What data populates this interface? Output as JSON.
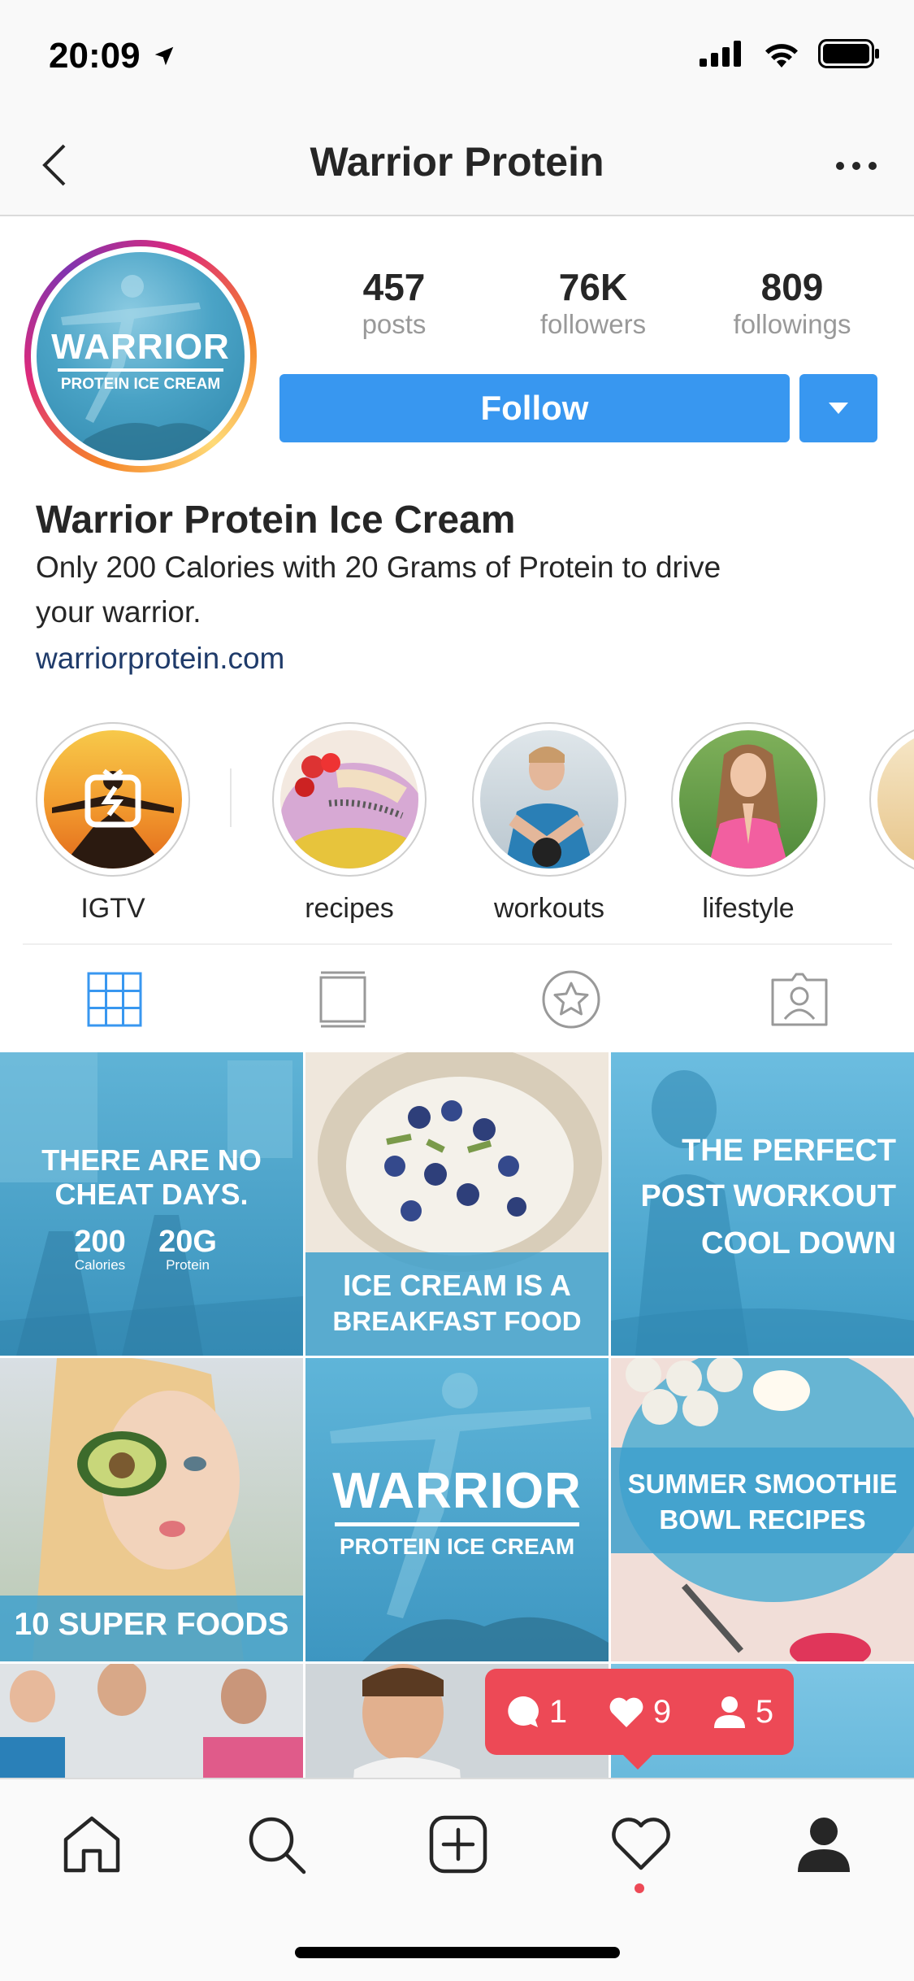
{
  "status_bar": {
    "time": "20:09"
  },
  "header": {
    "title": "Warrior Protein"
  },
  "profile": {
    "avatar_text": "WARRIOR",
    "avatar_subtext": "PROTEIN ICE CREAM",
    "stats": [
      {
        "value": "457",
        "label": "posts"
      },
      {
        "value": "76K",
        "label": "followers"
      },
      {
        "value": "809",
        "label": "followings"
      }
    ],
    "follow_label": "Follow",
    "name": "Warrior Protein Ice Cream",
    "bio": "Only 200 Calories with 20 Grams of Protein to drive your warrior.",
    "website": "warriorprotein.com"
  },
  "highlights": [
    {
      "label": "IGTV",
      "icon": "igtv-icon"
    },
    {
      "label": "recipes"
    },
    {
      "label": "workouts"
    },
    {
      "label": "lifestyle"
    }
  ],
  "tabs": [
    {
      "name": "grid-icon",
      "active": true
    },
    {
      "name": "feed-icon"
    },
    {
      "name": "star-icon"
    },
    {
      "name": "tagged-icon"
    }
  ],
  "posts": {
    "p1": {
      "line1": "THERE ARE NO",
      "line2": "CHEAT DAYS.",
      "v1": "200",
      "l1": "Calories",
      "v2": "20G",
      "l2": "Protein"
    },
    "p2": {
      "line1": "ICE CREAM IS A",
      "line2": "BREAKFAST FOOD"
    },
    "p3": {
      "line1": "THE PERFECT",
      "line2": "POST WORKOUT",
      "line3": "COOL DOWN"
    },
    "p4": {
      "line1": "10 SUPER FOODS"
    },
    "p5": {
      "line1": "WARRIOR",
      "line2": "PROTEIN ICE CREAM"
    },
    "p6": {
      "line1": "SUMMER SMOOTHIE",
      "line2": "BOWL RECIPES"
    }
  },
  "notification": {
    "comments": "1",
    "likes": "9",
    "follows": "5"
  },
  "bottom_nav": [
    "home-icon",
    "search-icon",
    "add-post-icon",
    "activity-heart-icon",
    "profile-icon"
  ],
  "colors": {
    "accent": "#3897f0",
    "notification": "#ed4956",
    "brand_blue": "#4aa6cf"
  }
}
